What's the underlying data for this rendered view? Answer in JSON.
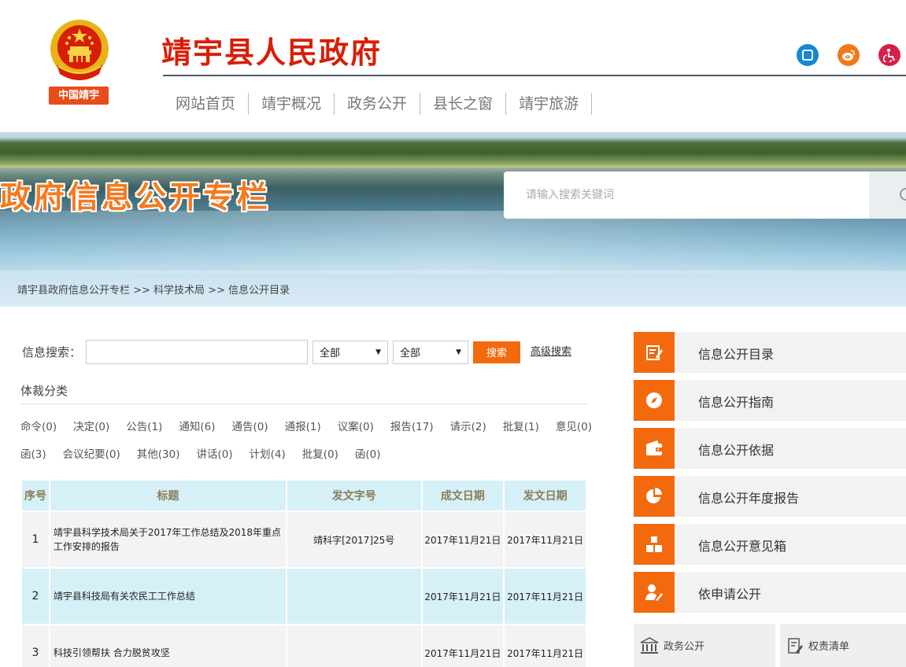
{
  "header": {
    "emblem_tag": "中国靖宇",
    "site_title": "靖宇县人民政府",
    "nav": [
      "网站首页",
      "靖宇概况",
      "政务公开",
      "县长之窗",
      "靖宇旅游"
    ],
    "icons": [
      "wechat-icon",
      "weibo-icon",
      "accessibility-icon"
    ]
  },
  "banner": {
    "title": "政府信息公开专栏",
    "search_placeholder": "请输入搜索关键词",
    "breadcrumb": "靖宇县政府信息公开专栏 >> 科学技术局 >> 信息公开目录"
  },
  "search": {
    "label": "信息搜索：",
    "select1": "全部",
    "select2": "全部",
    "button": "搜索",
    "advanced": "高级搜索"
  },
  "categories": {
    "title": "体裁分类",
    "row1": [
      "命令(0)",
      "决定(0)",
      "公告(1)",
      "通知(6)",
      "通告(0)",
      "通报(1)",
      "议案(0)",
      "报告(17)",
      "请示(2)",
      "批复(1)",
      "意见(0)"
    ],
    "row2": [
      "函(3)",
      "会议纪要(0)",
      "其他(30)",
      "讲话(0)",
      "计划(4)",
      "批复(0)",
      "函(0)"
    ]
  },
  "table": {
    "headers": [
      "序号",
      "标题",
      "发文字号",
      "成文日期",
      "发文日期"
    ],
    "rows": [
      {
        "no": "1",
        "title": "靖宇县科学技术局关于2017年工作总结及2018年重点工作安排的报告",
        "doc_no": "靖科字[2017]25号",
        "written": "2017年11月21日",
        "issued": "2017年11月21日"
      },
      {
        "no": "2",
        "title": "靖宇县科技局有关农民工工作总结",
        "doc_no": "",
        "written": "2017年11月21日",
        "issued": "2017年11月21日"
      },
      {
        "no": "3",
        "title": "科技引领帮扶 合力脱贫攻坚",
        "doc_no": "",
        "written": "2017年11月21日",
        "issued": "2017年11月21日"
      }
    ]
  },
  "side_menu": [
    {
      "label": "信息公开目录",
      "icon": "edit-list-icon"
    },
    {
      "label": "信息公开指南",
      "icon": "compass-icon"
    },
    {
      "label": "信息公开依据",
      "icon": "wallet-icon"
    },
    {
      "label": "信息公开年度报告",
      "icon": "pie-chart-icon"
    },
    {
      "label": "信息公开意见箱",
      "icon": "boxes-icon"
    },
    {
      "label": "依申请公开",
      "icon": "user-edit-icon"
    }
  ],
  "bottom_tabs": [
    {
      "label": "政务公开",
      "icon": "government-building-icon"
    },
    {
      "label": "权责清单",
      "icon": "document-edit-icon"
    }
  ],
  "colors": {
    "accent": "#f26a0d",
    "title_red": "#d81e06",
    "table_blue": "#d6f0f8"
  }
}
